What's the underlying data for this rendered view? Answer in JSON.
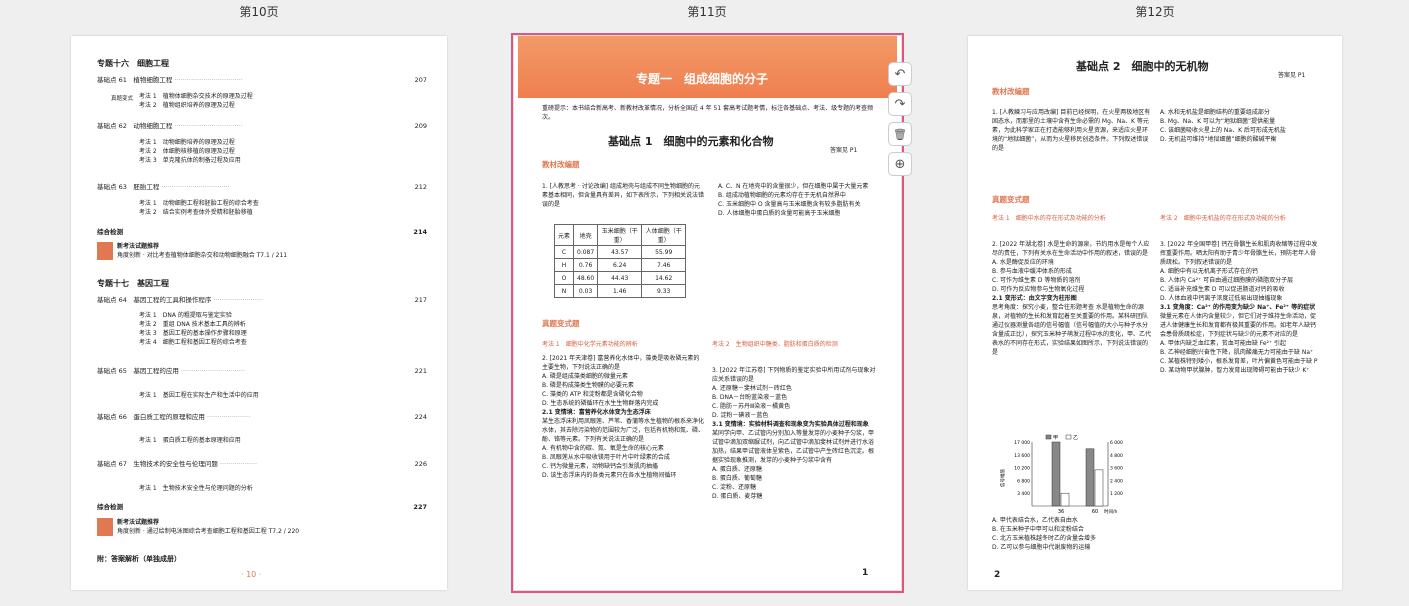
{
  "page_labels": {
    "p10": "第10页",
    "p11": "第11页",
    "p12": "第12页"
  },
  "toolbar": {
    "rotate_left": "↶",
    "rotate_right": "↷",
    "delete": "🗑",
    "add": "⊕"
  },
  "p10": {
    "topic16_title": "专题十六　细胞工程",
    "t16_items": [
      {
        "label": "基础点 61　植物细胞工程",
        "page": "207"
      },
      {
        "label": "基础点 62　动物细胞工程",
        "page": "209"
      },
      {
        "label": "基础点 63　胚胎工程",
        "page": "212"
      }
    ],
    "t16_sub1": [
      "考法 1　植物体细胞杂交技术的原理及过程",
      "考法 2　植物组织培养的原理及过程"
    ],
    "t16_sub2": [
      "考法 1　动物细胞培养的原理及过程",
      "考法 2　体细胞核移植的原理及过程",
      "考法 3　单克隆抗体的制备过程及应用"
    ],
    "t16_sub3": [
      "考法 1　动物细胞工程和胚胎工程的综合考查",
      "考法 2　结合实例考查体外受精和胚胎移植"
    ],
    "t16_comp": "综合检测",
    "t16_comp_page": "214",
    "t16_rec_title": "新考法试题推荐",
    "t16_rec_text": "角度创新 · 对比考查植物体细胞杂交和动物细胞融合 T7.1 / 211",
    "topic17_title": "专题十七　基因工程",
    "t17_items": [
      {
        "label": "基础点 64　基因工程的工具和操作程序",
        "page": "217"
      },
      {
        "label": "基础点 65　基因工程的应用",
        "page": "221"
      },
      {
        "label": "基础点 66　蛋白质工程的原理和应用",
        "page": "224"
      },
      {
        "label": "基础点 67　生物技术的安全性与伦理问题",
        "page": "226"
      }
    ],
    "t17_sub1": [
      "考法 1　DNA 的粗提取与鉴定实验",
      "考法 2　重组 DNA 技术基本工具的辨析",
      "考法 3　基因工程的基本操作步骤和原理",
      "考法 4　细胞工程和基因工程的综合考查"
    ],
    "t17_sub2": [
      "考法 1　基因工程在实际生产和生活中的应用"
    ],
    "t17_sub3": [
      "考法 1　蛋白质工程的基本原理和应用"
    ],
    "t17_sub4": [
      "考法 1　生物技术安全性与伦理问题的分析"
    ],
    "t17_comp": "综合检测",
    "t17_comp_page": "227",
    "t17_rec_title": "新考法试题推荐",
    "t17_rec_text": "角度创新 · 通过绘制电泳图综合考查细胞工程和基因工程 T7.2 / 220",
    "appendix": "附：答案解析（单独成册）",
    "page_no": "· 10 ·",
    "side_label": "真题变式"
  },
  "p11": {
    "chapter": "专题一　组成细胞的分子",
    "intro": "重磅提示：本书结合新高考、新教材改革情况，分析全国近 4 年 51 套高考试题考情，标注各基础点、考法、级专题的考查频次。",
    "bp_title": "基础点 1　细胞中的元素和化合物",
    "answer_ref": "答案见 P1",
    "sec_basic": "教材改编题",
    "q1": "1. [人教思考 · 讨论改编] 组成地壳与组成不同生物细胞的元素基本相同，但含量具有差异，如下表所示，下列相关说法错误的是",
    "table_head": [
      "元素",
      "地壳",
      "玉米细胞（干重）",
      "人体细胞（干重）"
    ],
    "table_rows": [
      [
        "C",
        "0.087",
        "43.57",
        "55.99"
      ],
      [
        "H",
        "0.76",
        "6.24",
        "7.46"
      ],
      [
        "O",
        "48.60",
        "44.43",
        "14.62"
      ],
      [
        "N",
        "0.03",
        "1.46",
        "9.33"
      ]
    ],
    "q1_opts": [
      "A. C、N 在地壳中的含量很少，但在细胞中属于大量元素",
      "B. 组成动植物细胞的元素均存在于无机自然界中",
      "C. 玉米细胞中 O 含量高与玉米细胞含有较多脂肪有关",
      "D. 人体细胞中蛋白质的含量可能高于玉米细胞"
    ],
    "sec_real": "真题变式题",
    "m1": "考法 1　细胞中化学元素功能的辨析",
    "m2": "考法 2　生物组织中糖类、脂肪和蛋白质的检测",
    "q2": "2. [2021 年天津卷] 富营养化水体中，藻类是吸收磷元素的主要生物，下列说法正确的是",
    "q2_opts": [
      "A. 磷是组成藻类细胞的微量元素",
      "B. 磷是构成藻类生物膜的必要元素",
      "C. 藻类的 ATP 和淀粉都是含磷化合物",
      "D. 生态系统的磷循环在水生生物群落内完成"
    ],
    "v21_title": "2.1 变情境：富营养化水体变为生态浮床",
    "v21_text": "某生态浮床利用凤眼莲、芦苇、香蒲等水生植物的根系来净化水体，其去除污染物的范围较为广泛，包括有机物和氮、磷、酚、铬等元素。下列有关说法正确的是",
    "v21_opts": [
      "A. 有机物中含的碳、氮、氧是生命的核心元素",
      "B. 凤眼莲从水中吸收镁用于叶片中叶绿素的合成",
      "C. 钙为微量元素，动物缺钙会引发肌肉抽搐",
      "D. 该生态浮床内的各类元素只在各水生植物间循环"
    ],
    "q3": "3. [2022 年江苏卷] 下列物质的鉴定实验中所用试剂与现象对应关系错误的是",
    "q3_opts": [
      "A. 还原糖－斐林试剂－砖红色",
      "B. DNA－台盼蓝染液－蓝色",
      "C. 脂肪－苏丹Ⅲ染液－橘黄色",
      "D. 淀粉－碘液－蓝色"
    ],
    "v31_title": "3.1 变情境：实验材料调查和现象变为实验具体过程和现象",
    "v31_text": "某同学向甲、乙试管内分别加入等量发芽的小麦种子匀浆，甲试管中滴加双缩脲试剂，向乙试管中滴加斐林试剂并进行水浴加热，结果甲试管液体呈紫色，乙试管中产生砖红色沉淀。根据实验现象推测，发芽的小麦种子匀浆中含有",
    "v31_opts": [
      "A. 蛋白质、还原糖",
      "B. 蛋白质、葡萄糖",
      "C. 淀粉、还原糖",
      "D. 蛋白质、麦芽糖"
    ],
    "page_no": "1"
  },
  "p12": {
    "bp_title": "基础点 2　细胞中的无机物",
    "answer_ref": "答案见 P1",
    "sec_basic": "教材改编题",
    "q1": "1. [人教練习与应用改编] 目前已经探明，在火星两极地区有固态水，而那里的土壤中含有生命必需的 Mg、Na、K 等元素，为此科学家正在打造能够利用火星资源，来适应火星环境的“地狱细菌”，从而为火星移民创造条件。下列叙述错误的是",
    "q1_opts": [
      "A. 水和无机盐是细胞结构的重要组成部分",
      "B. Mg、Na、K 可以为“地狱细菌”提供能量",
      "C. 该细菌吸收火星上的 Na、K 后可形成无机盐",
      "D. 无机盐可维持“地狱细菌”细胞的酸碱平衡"
    ],
    "sec_real": "真题变式题",
    "m1": "考法 1　细胞中水的存在形式及功能的分析",
    "m2": "考法 2　细胞中无机盐的存在形式及功能的分析",
    "q2": "2. [2022 年湖北卷] 水是生命的源泉，节约用水是每个人应尽的责任，下列有关水在生命活动中作用的叙述，错误的是",
    "q2_opts": [
      "A. 水是酶促反应的环境",
      "B. 参与血液中缓冲体系的形成",
      "C. 可作为维生素 D 等物质的溶剂",
      "D. 可作为反应物参与生物氧化过程"
    ],
    "v21_title": "2.1 变形式：由文字变为柱形图",
    "v21_text": "思考角度：探究小麦，整合往形题考查 水是植物生命的源泉，对植物的生长和发育起着至关重要的作用。某科研团队通过仪器测量各组的信号幅值（信号幅值的大小与种子水分含量成正比），探究玉米种子萌发过程中水的变化，甲、乙代表水的不同存在形式，实验结果如图所示，下列说法错误的是",
    "legend": [
      "甲",
      "乙"
    ],
    "v21_opts": [
      "A. 甲代表结合水，乙代表自由水",
      "B. 在玉米种子中甲可以和淀粉结合",
      "C. 北方玉米植株越冬时乙的含量会增多",
      "D. 乙可以参与细胞中代谢废物的运输"
    ],
    "q3": "3. [2022 年全国甲卷] 钙在骨骼生长和肌肉收缩等过程中发挥重要作用。晒太阳有助于青少年骨骼生长，预防老年人骨质疏松。下列叙述错误的是",
    "q3_opts": [
      "A. 细胞中有以无机离子形式存在的钙",
      "B. 人体内 Ca²⁺ 可自由通过细胞膜的磷脂双分子层",
      "C. 适当补充维生素 D 可以促进肠道对钙的吸收",
      "D. 人体血液中钙离子浓度过低易出现抽搐现象"
    ],
    "v31_title": "3.1 变角度：Ca²⁺ 的作用变为缺少 Na⁺、Fe²⁺ 等的症状",
    "v31_text": "微量元素在人体内含量较少，但它们对于维持生命活动，促进人体健康生长和发育都有极其重要的作用。如老年人缺钙会患骨质疏松症，下列症状与缺少的元素不对应的是",
    "v31_opts": [
      "A. 甲体内缺乏血红素，贫血可能由缺 Fe²⁺ 引起",
      "B. 乙神经细胞兴奋性下降，肌肉酸痛无力可能由于缺 Na⁺",
      "C. 某植株特别矮小，根系发育差，叶片偏黄色可能由于缺 P",
      "D. 某动物甲状腺肿，智力发育出现障碍可能由于缺少 K⁺"
    ],
    "page_no": "2"
  },
  "chart_data": {
    "type": "bar",
    "categories": [
      "36",
      "60"
    ],
    "series": [
      {
        "name": "甲",
        "values": [
          17000,
          15200
        ]
      },
      {
        "name": "乙",
        "values": [
          3400,
          9600
        ]
      }
    ],
    "yticks_left": [
      "17 000",
      "13 600",
      "10 200",
      "6 800",
      "3 400"
    ],
    "yticks_right": [
      "6 000",
      "4 800",
      "3 600",
      "2 400",
      "1 200"
    ],
    "ylabel": "信号幅值",
    "xlabel": "时间/h",
    "ylim": [
      0,
      17000
    ]
  }
}
